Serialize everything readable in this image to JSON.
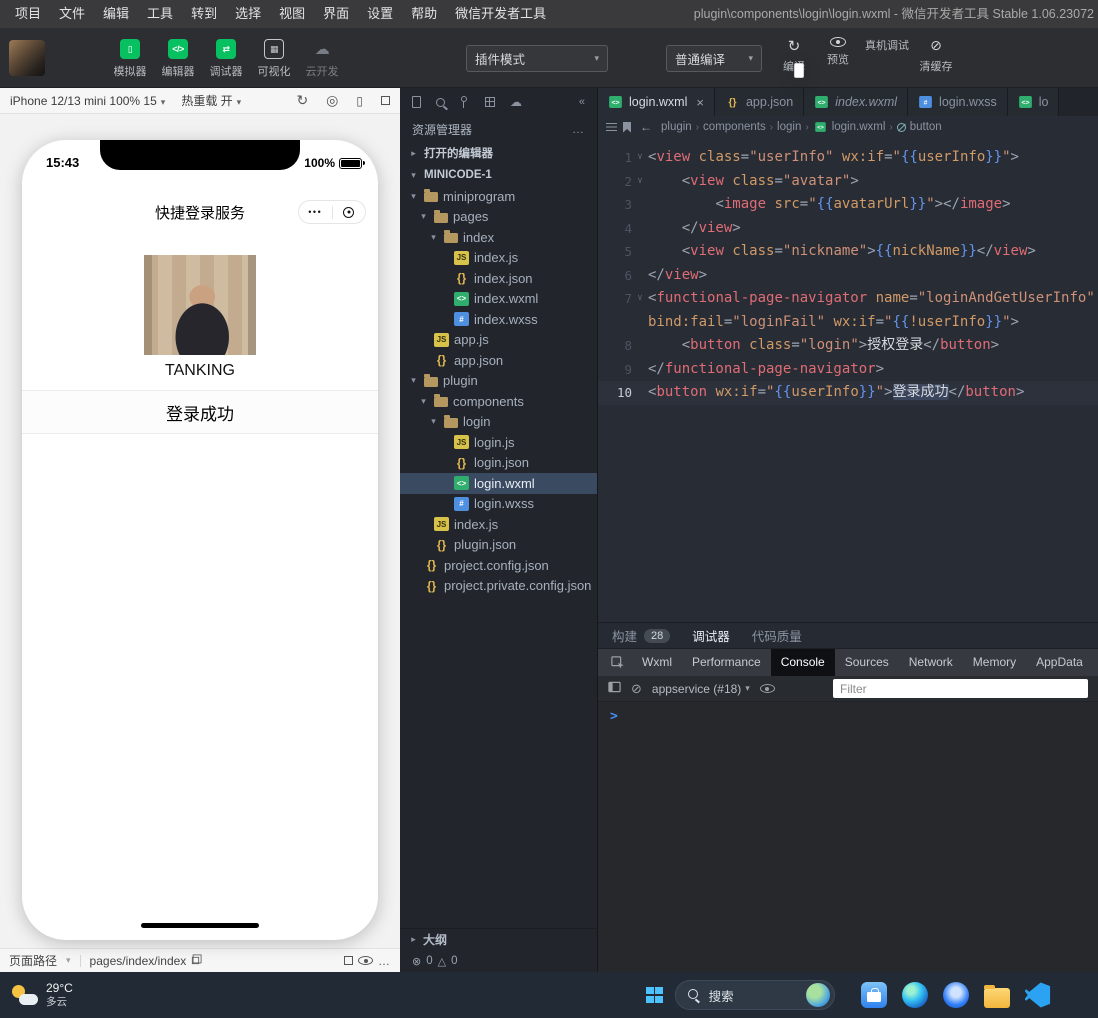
{
  "menu_bar": {
    "items": [
      "项目",
      "文件",
      "编辑",
      "工具",
      "转到",
      "选择",
      "视图",
      "界面",
      "设置",
      "帮助",
      "微信开发者工具"
    ],
    "window_title": "plugin\\components\\login\\login.wxml - 微信开发者工具 Stable 1.06.23072"
  },
  "toolbar": {
    "nav": [
      {
        "name": "simulator",
        "label": "模拟器",
        "glyph": "▯"
      },
      {
        "name": "editor",
        "label": "编辑器",
        "glyph": "</>"
      },
      {
        "name": "debugger",
        "label": "调试器",
        "glyph": "⇄"
      },
      {
        "name": "visualizer",
        "label": "可视化",
        "glyph": "▦",
        "variant": "outline"
      },
      {
        "name": "cloud-dev",
        "label": "云开发",
        "glyph": "☁",
        "variant": "disabled"
      }
    ],
    "plugin_mode": "插件模式",
    "compile_mode": "普通编译",
    "actions": [
      {
        "name": "compile",
        "label": "编译",
        "icon": "refresh"
      },
      {
        "name": "preview",
        "label": "预览",
        "icon": "eye"
      },
      {
        "name": "remote-debug",
        "label": "真机调试",
        "icon": "phone"
      },
      {
        "name": "clear-cache",
        "label": "清缓存",
        "icon": "clear"
      }
    ]
  },
  "simulator": {
    "device": "iPhone 12/13 mini 100% 15",
    "hot_reload_label": "热重载 开",
    "phone": {
      "time": "15:43",
      "battery_pct": "100%",
      "nav_title": "快捷登录服务",
      "capsule_dots": "•••",
      "nickname": "TANKING",
      "button_label": "登录成功"
    },
    "bottom": {
      "path_label": "页面路径",
      "path_value": "pages/index/index"
    }
  },
  "explorer": {
    "title": "资源管理器",
    "more_label": "…",
    "open_editors_label": "打开的编辑器",
    "root_label": "MINICODE-1",
    "items": [
      {
        "label": "miniprogram",
        "icon": "folder",
        "indent": 0,
        "folder": true
      },
      {
        "label": "pages",
        "icon": "folder",
        "indent": 1,
        "folder": true
      },
      {
        "label": "index",
        "icon": "folder",
        "indent": 2,
        "folder": true
      },
      {
        "label": "index.js",
        "icon": "js",
        "indent": 3
      },
      {
        "label": "index.json",
        "icon": "json",
        "indent": 3
      },
      {
        "label": "index.wxml",
        "icon": "wxml",
        "indent": 3
      },
      {
        "label": "index.wxss",
        "icon": "wxss",
        "indent": 3
      },
      {
        "label": "app.js",
        "icon": "js",
        "indent": 1
      },
      {
        "label": "app.json",
        "icon": "json",
        "indent": 1
      },
      {
        "label": "plugin",
        "icon": "folder",
        "indent": 0,
        "folder": true
      },
      {
        "label": "components",
        "icon": "folder",
        "indent": 1,
        "folder": true
      },
      {
        "label": "login",
        "icon": "folder",
        "indent": 2,
        "folder": true
      },
      {
        "label": "login.js",
        "icon": "js",
        "indent": 3
      },
      {
        "label": "login.json",
        "icon": "json",
        "indent": 3
      },
      {
        "label": "login.wxml",
        "icon": "wxml",
        "indent": 3,
        "selected": true
      },
      {
        "label": "login.wxss",
        "icon": "wxss",
        "indent": 3
      },
      {
        "label": "index.js",
        "icon": "js",
        "indent": 1
      },
      {
        "label": "plugin.json",
        "icon": "json",
        "indent": 1
      },
      {
        "label": "project.config.json",
        "icon": "json",
        "indent": 0
      },
      {
        "label": "project.private.config.json",
        "icon": "json",
        "indent": 0
      }
    ],
    "outline_label": "大纲",
    "errors": "0",
    "warnings": "0"
  },
  "editor": {
    "tabs": [
      {
        "label": "login.wxml",
        "icon": "wxml",
        "active": true,
        "closable": true
      },
      {
        "label": "app.json",
        "icon": "json"
      },
      {
        "label": "index.wxml",
        "icon": "wxml",
        "italic": true
      },
      {
        "label": "login.wxss",
        "icon": "wxss"
      },
      {
        "label": "lo",
        "icon": "wxml"
      }
    ],
    "breadcrumb": [
      "plugin",
      "components",
      "login",
      "login.wxml",
      "button"
    ],
    "code": {
      "lines": [
        {
          "n": "1",
          "fold": true,
          "tokens": [
            [
              "p",
              "<"
            ],
            [
              "t",
              "view"
            ],
            [
              "x",
              " "
            ],
            [
              "a",
              "class"
            ],
            [
              "p",
              "="
            ],
            [
              "s",
              "\"userInfo\""
            ],
            [
              "x",
              " "
            ],
            [
              "a",
              "wx:if"
            ],
            [
              "p",
              "="
            ],
            [
              "s",
              "\""
            ],
            [
              "m",
              "{{"
            ],
            [
              "a",
              "userInfo"
            ],
            [
              "m",
              "}}"
            ],
            [
              "s",
              "\""
            ],
            [
              "p",
              ">"
            ]
          ]
        },
        {
          "n": "2",
          "fold": true,
          "tokens": [
            [
              "x",
              "    "
            ],
            [
              "p",
              "<"
            ],
            [
              "t",
              "view"
            ],
            [
              "x",
              " "
            ],
            [
              "a",
              "class"
            ],
            [
              "p",
              "="
            ],
            [
              "s",
              "\"avatar\""
            ],
            [
              "p",
              ">"
            ]
          ]
        },
        {
          "n": "3",
          "tokens": [
            [
              "x",
              "        "
            ],
            [
              "p",
              "<"
            ],
            [
              "t",
              "image"
            ],
            [
              "x",
              " "
            ],
            [
              "a",
              "src"
            ],
            [
              "p",
              "="
            ],
            [
              "s",
              "\""
            ],
            [
              "m",
              "{{"
            ],
            [
              "a",
              "avatarUrl"
            ],
            [
              "m",
              "}}"
            ],
            [
              "s",
              "\""
            ],
            [
              "p",
              "></"
            ],
            [
              "t",
              "image"
            ],
            [
              "p",
              ">"
            ]
          ]
        },
        {
          "n": "4",
          "tokens": [
            [
              "x",
              "    "
            ],
            [
              "p",
              "</"
            ],
            [
              "t",
              "view"
            ],
            [
              "p",
              ">"
            ]
          ]
        },
        {
          "n": "5",
          "tokens": [
            [
              "x",
              "    "
            ],
            [
              "p",
              "<"
            ],
            [
              "t",
              "view"
            ],
            [
              "x",
              " "
            ],
            [
              "a",
              "class"
            ],
            [
              "p",
              "="
            ],
            [
              "s",
              "\"nickname\""
            ],
            [
              "p",
              ">"
            ],
            [
              "m",
              "{{"
            ],
            [
              "a",
              "nickName"
            ],
            [
              "m",
              "}}"
            ],
            [
              "p",
              "</"
            ],
            [
              "t",
              "view"
            ],
            [
              "p",
              ">"
            ]
          ]
        },
        {
          "n": "6",
          "tokens": [
            [
              "p",
              "</"
            ],
            [
              "t",
              "view"
            ],
            [
              "p",
              ">"
            ]
          ]
        },
        {
          "n": "7",
          "fold": true,
          "tokens": [
            [
              "p",
              "<"
            ],
            [
              "t",
              "functional-page-navigator"
            ],
            [
              "x",
              " "
            ],
            [
              "a",
              "name"
            ],
            [
              "p",
              "="
            ],
            [
              "s",
              "\"loginAndGetUserInfo\""
            ],
            [
              "x",
              " "
            ]
          ]
        },
        {
          "n": "",
          "tokens": [
            [
              "a",
              "bind:fail"
            ],
            [
              "p",
              "="
            ],
            [
              "s",
              "\"loginFail\""
            ],
            [
              "x",
              " "
            ],
            [
              "a",
              "wx:if"
            ],
            [
              "p",
              "="
            ],
            [
              "s",
              "\""
            ],
            [
              "m",
              "{{"
            ],
            [
              "a",
              "!userInfo"
            ],
            [
              "m",
              "}}"
            ],
            [
              "s",
              "\""
            ],
            [
              "p",
              ">"
            ]
          ]
        },
        {
          "n": "8",
          "tokens": [
            [
              "x",
              "    "
            ],
            [
              "p",
              "<"
            ],
            [
              "t",
              "button"
            ],
            [
              "x",
              " "
            ],
            [
              "a",
              "class"
            ],
            [
              "p",
              "="
            ],
            [
              "s",
              "\"login\""
            ],
            [
              "p",
              ">"
            ],
            [
              "x",
              "授权登录"
            ],
            [
              "p",
              "</"
            ],
            [
              "t",
              "button"
            ],
            [
              "p",
              ">"
            ]
          ]
        },
        {
          "n": "9",
          "tokens": [
            [
              "p",
              "</"
            ],
            [
              "t",
              "functional-page-navigator"
            ],
            [
              "p",
              ">"
            ]
          ]
        },
        {
          "n": "10",
          "current": true,
          "tokens": [
            [
              "p",
              "<"
            ],
            [
              "t",
              "button"
            ],
            [
              "x",
              " "
            ],
            [
              "a",
              "wx:if"
            ],
            [
              "p",
              "="
            ],
            [
              "s",
              "\""
            ],
            [
              "m",
              "{{"
            ],
            [
              "a",
              "userInfo"
            ],
            [
              "m",
              "}}"
            ],
            [
              "s",
              "\""
            ],
            [
              "p",
              ">"
            ],
            [
              "x",
              "登录成功",
              "sel"
            ],
            [
              "p",
              "</"
            ],
            [
              "t",
              "button"
            ],
            [
              "p",
              ">"
            ]
          ]
        }
      ]
    }
  },
  "debugger": {
    "build_tab": "构建",
    "build_count": "28",
    "debug_tab": "调试器",
    "quality_tab": "代码质量",
    "panels": [
      "Wxml",
      "Performance",
      "Console",
      "Sources",
      "Network",
      "Memory",
      "AppData"
    ],
    "active_panel": "Console",
    "context": "appservice (#18)",
    "filter_placeholder": "Filter",
    "prompt": ">"
  },
  "taskbar": {
    "weather_temp": "29°C",
    "weather_desc": "多云",
    "search_placeholder": "搜索"
  }
}
